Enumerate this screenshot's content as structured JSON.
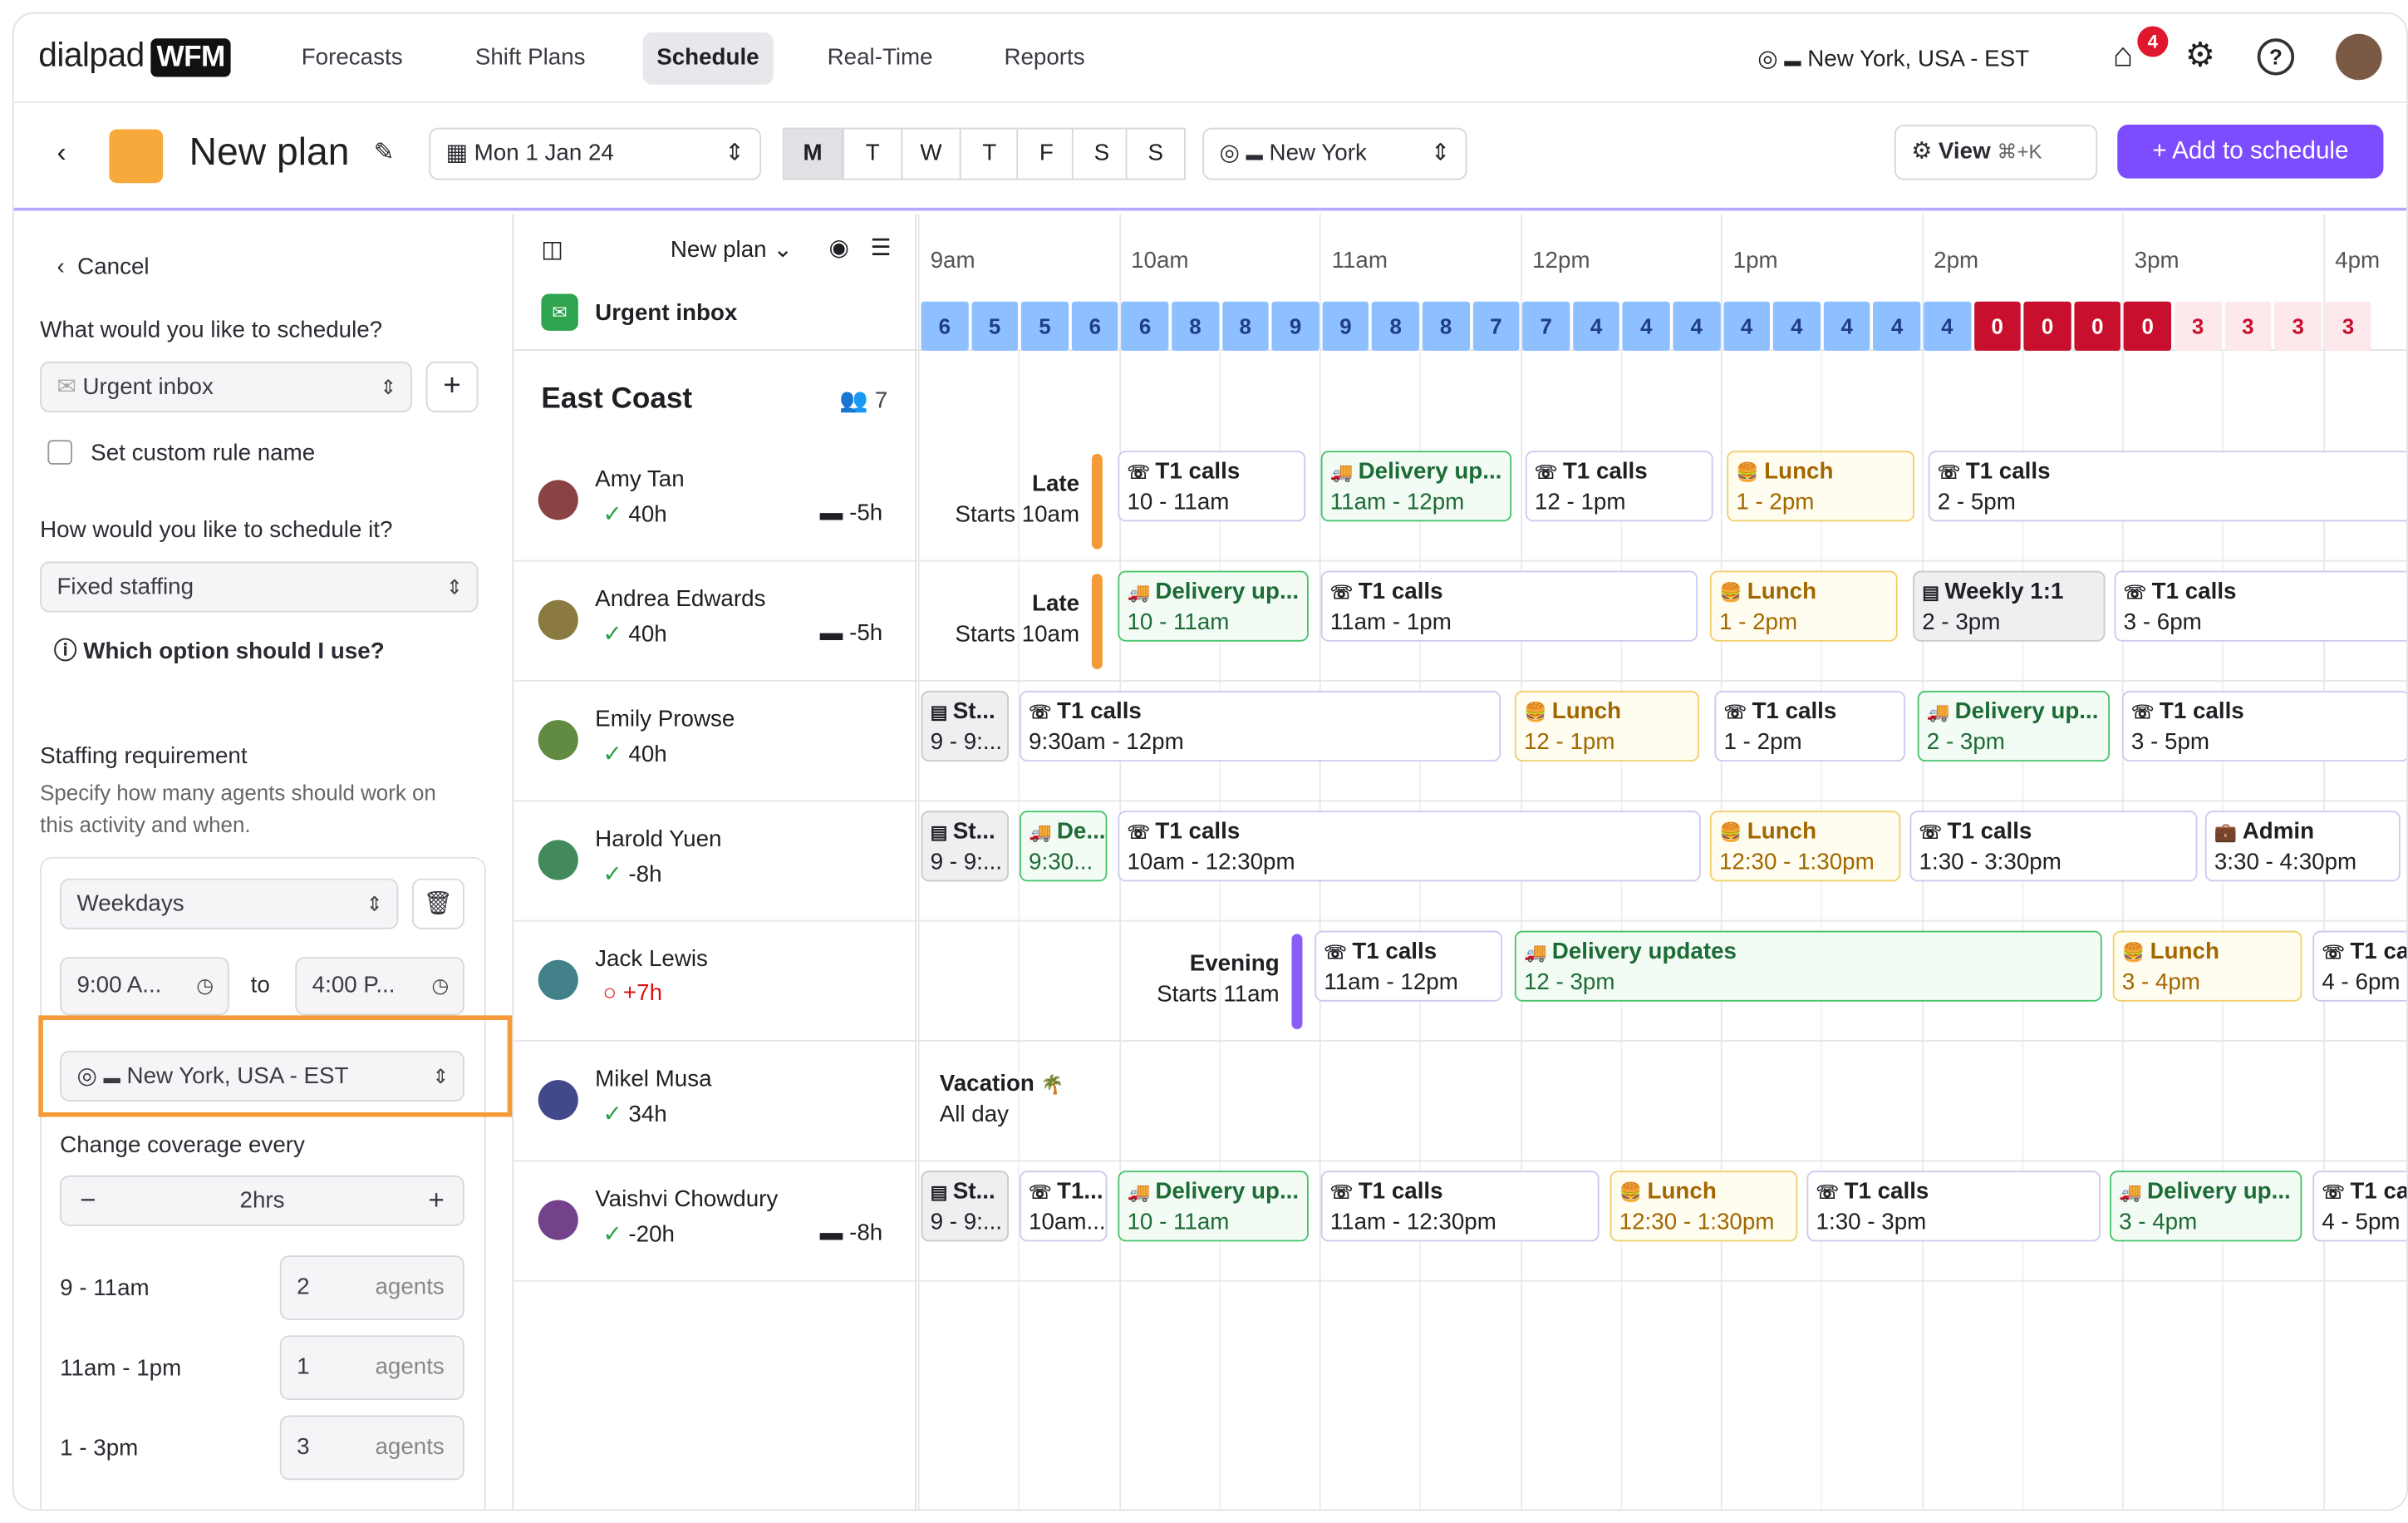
{
  "nav": {
    "logo": "dialpad",
    "logo_badge": "WFM",
    "items": [
      "Forecasts",
      "Shift Plans",
      "Schedule",
      "Real-Time",
      "Reports"
    ],
    "active": "Schedule",
    "timezone": "New York, USA - EST",
    "notif_count": "4"
  },
  "toolbar": {
    "title": "New plan",
    "date": "Mon 1 Jan 24",
    "days": [
      "M",
      "T",
      "W",
      "T",
      "F",
      "S",
      "S"
    ],
    "location": "New York",
    "view_label": "View",
    "view_shortcut": "⌘+K",
    "add_label": "Add to schedule"
  },
  "side": {
    "cancel": "Cancel",
    "q1": "What would you like to schedule?",
    "activity": "Urgent inbox",
    "custom_rule": "Set custom rule name",
    "q2": "How would you like to schedule it?",
    "method": "Fixed staffing",
    "help": "Which option should I use?",
    "req_title": "Staffing requirement",
    "req_desc1": "Specify how many agents should work on",
    "req_desc2": "this activity and when.",
    "days_select": "Weekdays",
    "from": "9:00 A...",
    "to_word": "to",
    "to": "4:00 P...",
    "tz": "New York, USA - EST",
    "coverage_label": "Change coverage every",
    "coverage": "2hrs",
    "ranges": [
      {
        "label": "9 - 11am",
        "value": "2",
        "unit": "agents"
      },
      {
        "label": "11am - 1pm",
        "value": "1",
        "unit": "agents"
      },
      {
        "label": "1 - 3pm",
        "value": "3",
        "unit": "agents"
      }
    ]
  },
  "grid": {
    "plan": "New plan",
    "inbox": "Urgent inbox",
    "hours": [
      "9am",
      "10am",
      "11am",
      "12pm",
      "1pm",
      "2pm",
      "3pm",
      "4pm"
    ],
    "coverage": [
      "6",
      "5",
      "5",
      "6",
      "6",
      "8",
      "8",
      "9",
      "9",
      "8",
      "8",
      "7",
      "7",
      "4",
      "4",
      "4",
      "4",
      "4",
      "4",
      "4",
      "4",
      "0",
      "0",
      "0",
      "0",
      "3",
      "3",
      "3",
      "3"
    ],
    "team": "East Coast",
    "team_count": "7"
  },
  "people": [
    {
      "name": "Amy Tan",
      "hours": "40h",
      "offset": "-5h",
      "shift": "Late",
      "starts": "Starts 10am",
      "blocks": [
        [
          "T1 calls",
          "10 - 11am"
        ],
        [
          "Delivery up...",
          "11am - 12pm"
        ],
        [
          "T1 calls",
          "12 - 1pm"
        ],
        [
          "Lunch",
          "1 - 2pm"
        ],
        [
          "T1 calls",
          "2 - 5pm"
        ]
      ]
    },
    {
      "name": "Andrea Edwards",
      "hours": "40h",
      "offset": "-5h",
      "shift": "Late",
      "starts": "Starts 10am",
      "blocks": [
        [
          "Delivery up...",
          "10 - 11am"
        ],
        [
          "T1 calls",
          "11am - 1pm"
        ],
        [
          "Lunch",
          "1 - 2pm"
        ],
        [
          "Weekly 1:1",
          "2 - 3pm"
        ],
        [
          "T1 calls",
          "3 - 6pm"
        ]
      ]
    },
    {
      "name": "Emily Prowse",
      "hours": "40h",
      "offset": "",
      "blocks": [
        [
          "St...",
          "9 - 9:..."
        ],
        [
          "T1 calls",
          "9:30am - 12pm"
        ],
        [
          "Lunch",
          "12 - 1pm"
        ],
        [
          "T1 calls",
          "1 - 2pm"
        ],
        [
          "Delivery up...",
          "2 - 3pm"
        ],
        [
          "T1 calls",
          "3 - 5pm"
        ]
      ]
    },
    {
      "name": "Harold Yuen",
      "hours": "-8h",
      "offset": "",
      "blocks": [
        [
          "St...",
          "9 - 9:..."
        ],
        [
          "De...",
          "9:30..."
        ],
        [
          "T1 calls",
          "10am - 12:30pm"
        ],
        [
          "Lunch",
          "12:30 - 1:30pm"
        ],
        [
          "T1 calls",
          "1:30 - 3:30pm"
        ],
        [
          "Admin",
          "3:30 - 4:30pm"
        ]
      ]
    },
    {
      "name": "Jack Lewis",
      "hours": "+7h",
      "offset": "",
      "shift": "Evening",
      "starts": "Starts 11am",
      "blocks": [
        [
          "T1 calls",
          "11am - 12pm"
        ],
        [
          "Delivery updates",
          "12 - 3pm"
        ],
        [
          "Lunch",
          "3 - 4pm"
        ],
        [
          "T1 ca",
          "4 - 6pm"
        ]
      ]
    },
    {
      "name": "Mikel Musa",
      "hours": "34h",
      "offset": "",
      "vacation": "Vacation",
      "vac_sub": "All day"
    },
    {
      "name": "Vaishvi Chowdury",
      "hours": "-20h",
      "offset": "-8h",
      "blocks": [
        [
          "St...",
          "9 - 9:..."
        ],
        [
          "T1...",
          "10am..."
        ],
        [
          "Delivery up...",
          "10 - 11am"
        ],
        [
          "T1 calls",
          "11am - 12:30pm"
        ],
        [
          "Lunch",
          "12:30 - 1:30pm"
        ],
        [
          "T1 calls",
          "1:30 - 3pm"
        ],
        [
          "Delivery up...",
          "3 - 4pm"
        ],
        [
          "T1 ca",
          "4 - 5pm"
        ]
      ]
    }
  ],
  "colors": {
    "accent": "#7c4dff",
    "coverage_ok": "#8ec0ff",
    "coverage_zero": "#c8102e",
    "coverage_low": "#fde8ec",
    "late_bar": "#f49a36",
    "evening_bar": "#8b5cf6"
  }
}
